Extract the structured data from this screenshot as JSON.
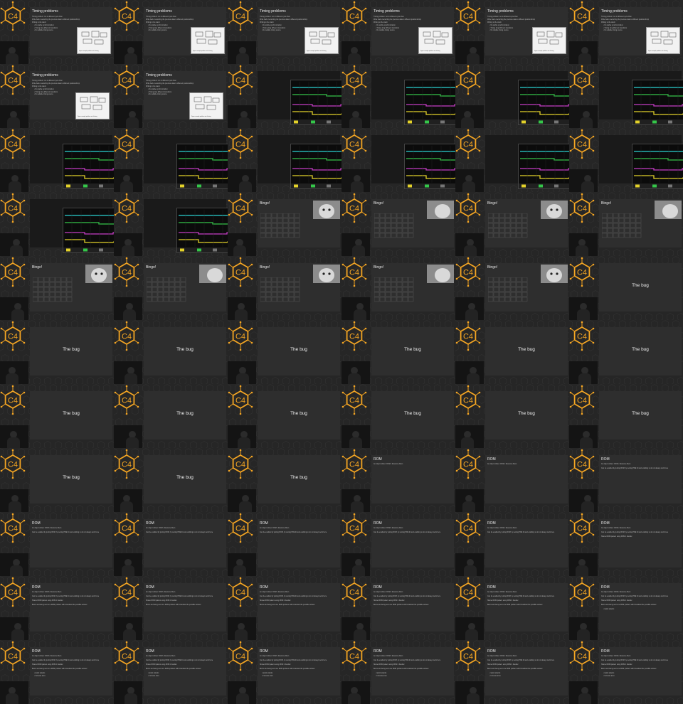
{
  "cells": [
    {
      "type": "timing1",
      "title": "Timing problems",
      "lines": [
        "Timing problem: run in different cycle than",
        "Write back overwriting the previous data to different positions/bmp",
        "Writing to the stack:"
      ],
      "bullets": [
        "No stable synchronization",
        "Timing long different transitions",
        "No reliable timing source"
      ],
      "figure_caption": "Figure: example problems out of timing"
    },
    {
      "type": "timing1",
      "title": "Timing problems",
      "lines": [
        "Timing problem: run in different cycle than",
        "Write back overwriting the previous data to different positions/bmp",
        "Writing to the stack:"
      ],
      "bullets": [
        "No stable synchronization",
        "Timing long different transitions",
        "No reliable timing source"
      ],
      "figure_caption": "Figure: example problems out of timing"
    },
    {
      "type": "timing1",
      "title": "Timing problems",
      "lines": [
        "Timing problem: run in different cycle than",
        "Write back overwriting the previous data to different positions/bmp",
        "Writing to the stack:"
      ],
      "bullets": [
        "No stable synchronization",
        "Timing long different transitions",
        "No reliable timing source"
      ],
      "figure_caption": "Figure: example problems out of timing"
    },
    {
      "type": "timing1",
      "title": "Timing problems",
      "lines": [
        "Timing problem: run in different cycle than",
        "Write back overwriting the previous data to different positions/bmp",
        "Writing to the stack:"
      ],
      "bullets": [
        "No stable synchronization",
        "Timing long different transitions",
        "No reliable timing source"
      ],
      "figure_caption": "Figure: example problems out of timing"
    },
    {
      "type": "timing1",
      "title": "Timing problems",
      "lines": [
        "Timing problem: run in different cycle than",
        "Write back overwriting the previous data to different positions/bmp",
        "Writing to the stack:"
      ],
      "bullets": [
        "No stable synchronization",
        "Timing long different transitions",
        "No reliable timing source"
      ],
      "figure_caption": "Figure: example problems out of timing"
    },
    {
      "type": "timing1",
      "title": "Timing problems",
      "lines": [
        "Timing problem: run in different cycle than",
        "Write back overwriting the previous data to different positions/bmp",
        "Writing to the stack:"
      ],
      "bullets": [
        "No stable synchronization",
        "Timing long different transitions",
        "No reliable timing source"
      ],
      "figure_caption": "Figure: example problems out of timing"
    },
    {
      "type": "timing2",
      "title": "Timing problems",
      "lines": [
        "Timing problem: run in different cycle than",
        "Write back overwriting the previous data to different positions/bmp",
        "Writing to the stack:"
      ],
      "bullets": [
        "No stable synchronization",
        "Timing long different transitions",
        "No reliable timing source"
      ],
      "figure_caption": "Figure: example problems out of timing"
    },
    {
      "type": "timing2",
      "title": "Timing problems",
      "lines": [
        "Timing problem: run in different cycle than",
        "Write back overwriting the previous data to different positions/bmp",
        "Writing to the stack:"
      ],
      "bullets": [
        "No stable synchronization",
        "Timing long different transitions",
        "No reliable timing source"
      ],
      "figure_caption": "Figure: example problems out of timing"
    },
    {
      "type": "scope"
    },
    {
      "type": "scope"
    },
    {
      "type": "scope"
    },
    {
      "type": "scope"
    },
    {
      "type": "scope"
    },
    {
      "type": "scope"
    },
    {
      "type": "scope"
    },
    {
      "type": "scope"
    },
    {
      "type": "scope"
    },
    {
      "type": "scope"
    },
    {
      "type": "scope"
    },
    {
      "type": "scope"
    },
    {
      "type": "bingo",
      "title": "Bingo!"
    },
    {
      "type": "bingo",
      "title": "Bingo!"
    },
    {
      "type": "bingo",
      "title": "Bingo!"
    },
    {
      "type": "bingo",
      "title": "Bingo!"
    },
    {
      "type": "bingo",
      "title": "Bingo!"
    },
    {
      "type": "bingo",
      "title": "Bingo!"
    },
    {
      "type": "bingo",
      "title": "Bingo!"
    },
    {
      "type": "bingo",
      "title": "Bingo!"
    },
    {
      "type": "bingo",
      "title": "Bingo!"
    },
    {
      "type": "bug",
      "text": "The bug"
    },
    {
      "type": "bug",
      "text": "The bug"
    },
    {
      "type": "bug",
      "text": "The bug"
    },
    {
      "type": "bug",
      "text": "The bug"
    },
    {
      "type": "bug",
      "text": "The bug"
    },
    {
      "type": "bug",
      "text": "The bug"
    },
    {
      "type": "bug",
      "text": "The bug"
    },
    {
      "type": "bug",
      "text": "The bug"
    },
    {
      "type": "bug",
      "text": "The bug"
    },
    {
      "type": "bug",
      "text": "The bug"
    },
    {
      "type": "bug",
      "text": "The bug"
    },
    {
      "type": "bug",
      "text": "The bug"
    },
    {
      "type": "bug",
      "text": "The bug"
    },
    {
      "type": "bug",
      "text": "The bug"
    },
    {
      "type": "bug",
      "text": "The bug"
    },
    {
      "type": "bug",
      "text": "The bug"
    },
    {
      "type": "rom",
      "title": "ROM",
      "lines": [
        "An object written: ROM • Resource Mem"
      ],
      "bullets": []
    },
    {
      "type": "rom",
      "title": "ROM",
      "lines": [
        "An object written: ROM • Resource Mem"
      ],
      "bullets": []
    },
    {
      "type": "rom",
      "title": "ROM",
      "lines": [
        "An object written: ROM • Resource Mem",
        "Can be enabled by putting ROM, by setting PRE bit and enabling to do not always work here"
      ],
      "bullets": []
    },
    {
      "type": "rom",
      "title": "ROM",
      "lines": [
        "An object written: ROM • Resource Mem",
        "Can be enabled by putting ROM, by setting PRE bit and enabling to do not always work here"
      ],
      "bullets": []
    },
    {
      "type": "rom",
      "title": "ROM",
      "lines": [
        "An object written: ROM • Resource Mem",
        "Can be enabled by putting ROM, by setting PRE bit and enabling to do not always work here"
      ],
      "bullets": []
    },
    {
      "type": "rom",
      "title": "ROM",
      "lines": [
        "An object written: ROM • Resource Mem",
        "Can be enabled by putting ROM, by setting PRE bit and enabling to do not always work here"
      ],
      "bullets": []
    },
    {
      "type": "rom",
      "title": "ROM",
      "lines": [
        "An object written: ROM • Resource Mem",
        "Can be enabled by putting ROM, by setting PRE bit and enabling to do not always work here"
      ],
      "bullets": []
    },
    {
      "type": "rom",
      "title": "ROM",
      "lines": [
        "An object written: ROM • Resource Mem",
        "Can be enabled by putting ROM, by setting PRE bit and enabling to do not always work here"
      ],
      "bullets": []
    },
    {
      "type": "rom",
      "title": "ROM",
      "lines": [
        "An object written: ROM • Resource Mem",
        "Can be enabled by putting ROM, by setting PRE bit and enabling to do not always work here",
        "Shared ROM pattern using ROM 1 handler"
      ],
      "bullets": []
    },
    {
      "type": "rom",
      "title": "ROM",
      "lines": [
        "An object written: ROM • Resource Mem",
        "Can be enabled by putting ROM, by setting PRE bit and enabling to do not always work here",
        "Shared ROM pattern using ROM 1 handler",
        "Boom and being sent one ROM problem with broadcast the possible answer"
      ],
      "bullets": []
    },
    {
      "type": "rom",
      "title": "ROM",
      "lines": [
        "An object written: ROM • Resource Mem",
        "Can be enabled by putting ROM, by setting PRE bit and enabling to do not always work here",
        "Shared ROM pattern using ROM 1 handler",
        "Boom and being sent one ROM problem with broadcast the possible answer"
      ],
      "bullets": []
    },
    {
      "type": "rom",
      "title": "ROM",
      "lines": [
        "An object written: ROM • Resource Mem",
        "Can be enabled by putting ROM, by setting PRE bit and enabling to do not always work here",
        "Shared ROM pattern using ROM 1 handler",
        "Boom and being sent one ROM problem with broadcast the possible answer"
      ],
      "bullets": []
    },
    {
      "type": "rom",
      "title": "ROM",
      "lines": [
        "An object written: ROM • Resource Mem",
        "Can be enabled by putting ROM, by setting PRE bit and enabling to do not always work here",
        "Shared ROM pattern using ROM 1 handler",
        "Boom and being sent one ROM problem with broadcast the possible answer"
      ],
      "bullets": []
    },
    {
      "type": "rom",
      "title": "ROM",
      "lines": [
        "An object written: ROM • Resource Mem",
        "Can be enabled by putting ROM, by setting PRE bit and enabling to do not always work here",
        "Shared ROM pattern using ROM 1 handler",
        "Boom and being sent one ROM problem with broadcast the possible answer"
      ],
      "bullets": []
    },
    {
      "type": "rom",
      "title": "ROM",
      "lines": [
        "An object written: ROM • Resource Mem",
        "Can be enabled by putting ROM, by setting PRE bit and enabling to do not always work here",
        "Shared ROM pattern using ROM 1 handler",
        "Boom and being sent one ROM problem with broadcast the possible answer"
      ],
      "bullets": [
        "Quick attacks"
      ]
    },
    {
      "type": "rom",
      "title": "ROM",
      "lines": [
        "An object written: ROM • Resource Mem",
        "Can be enabled by putting ROM, by setting PRE bit and enabling to do not always work here",
        "Shared ROM pattern using ROM 1 handler",
        "Boom and being sent one ROM problem with broadcast the possible answer"
      ],
      "bullets": [
        "Quick attacks",
        "Increase area"
      ]
    },
    {
      "type": "rom",
      "title": "ROM",
      "lines": [
        "An object written: ROM • Resource Mem",
        "Can be enabled by putting ROM, by setting PRE bit and enabling to do not always work here",
        "Shared ROM pattern using ROM 1 handler",
        "Boom and being sent one ROM problem with broadcast the possible answer"
      ],
      "bullets": [
        "Quick attacks",
        "Increase area"
      ]
    },
    {
      "type": "rom",
      "title": "ROM",
      "lines": [
        "An object written: ROM • Resource Mem",
        "Can be enabled by putting ROM, by setting PRE bit and enabling to do not always work here",
        "Shared ROM pattern using ROM 1 handler",
        "Boom and being sent one ROM problem with broadcast the possible answer"
      ],
      "bullets": [
        "Quick attacks",
        "Increase area"
      ]
    },
    {
      "type": "rom",
      "title": "ROM",
      "lines": [
        "An object written: ROM • Resource Mem",
        "Can be enabled by putting ROM, by setting PRE bit and enabling to do not always work here",
        "Shared ROM pattern using ROM 1 handler",
        "Boom and being sent one ROM problem with broadcast the possible answer"
      ],
      "bullets": [
        "Quick attacks",
        "Increase area"
      ]
    },
    {
      "type": "rom",
      "title": "ROM",
      "lines": [
        "An object written: ROM • Resource Mem",
        "Can be enabled by putting ROM, by setting PRE bit and enabling to do not always work here",
        "Shared ROM pattern using ROM 1 handler",
        "Boom and being sent one ROM problem with broadcast the possible answer"
      ],
      "bullets": [
        "Quick attacks",
        "Increase area"
      ]
    },
    {
      "type": "rom",
      "title": "ROM",
      "lines": [
        "An object written: ROM • Resource Mem",
        "Can be enabled by putting ROM, by setting PRE bit and enabling to do not always work here",
        "Shared ROM pattern using ROM 1 handler",
        "Boom and being sent one ROM problem with broadcast the possible answer"
      ],
      "bullets": [
        "Quick attacks",
        "Increase area"
      ]
    }
  ],
  "logo_text": "C4",
  "colors": {
    "accent": "#f5a623",
    "background": "#1f1f1f",
    "slide": "#2e2e2e",
    "scope_cyan": "#2ad4d4",
    "scope_green": "#35c74a",
    "scope_magenta": "#c63cc6",
    "scope_yellow": "#e4d22a"
  }
}
